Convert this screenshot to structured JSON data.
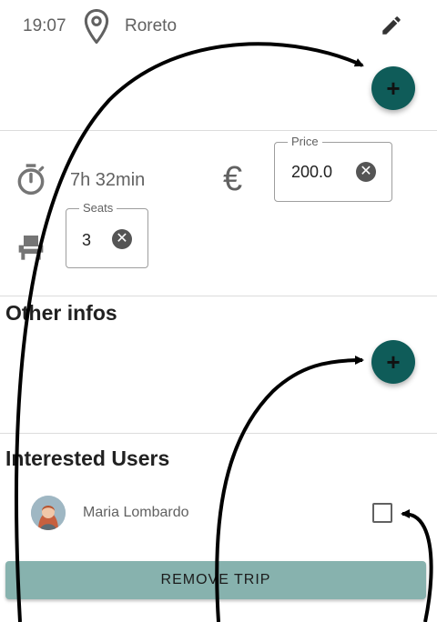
{
  "stop": {
    "time": "19:07",
    "location": "Roreto",
    "location_icon": "map-pin-icon",
    "edit_icon": "pencil-icon"
  },
  "add_stop_button": {
    "icon": "plus-icon",
    "glyph": "+"
  },
  "trip": {
    "duration": "7h 32min",
    "duration_icon": "stopwatch-icon",
    "currency_symbol": "€",
    "seat_icon": "seat-icon",
    "price": {
      "label": "Price",
      "value": "200.0"
    },
    "seats": {
      "label": "Seats",
      "value": "3"
    }
  },
  "other_infos": {
    "title": "Other infos",
    "add_button": {
      "icon": "plus-icon",
      "glyph": "+"
    }
  },
  "interested_users": {
    "title": "Interested Users",
    "users": [
      {
        "name": "Maria Lombardo",
        "selected": false
      }
    ]
  },
  "remove_trip_label": "REMOVE TRIP",
  "colors": {
    "fab": "#0f5c59",
    "remove_button": "#87b2ae",
    "text_secondary": "#616161"
  },
  "clear_glyph": "✕"
}
